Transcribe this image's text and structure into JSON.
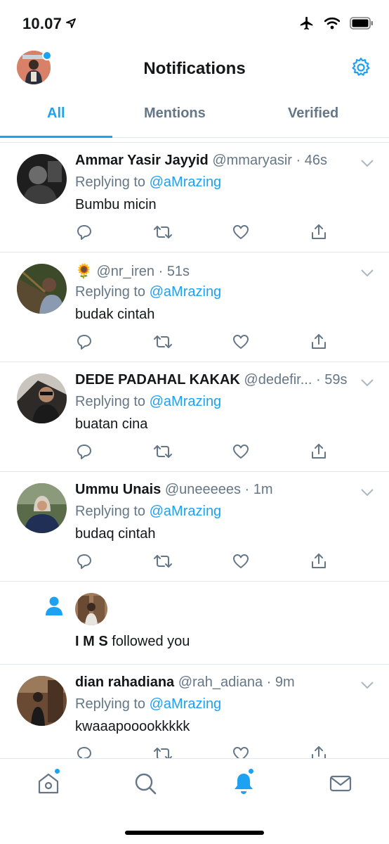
{
  "status_bar": {
    "time": "10.07"
  },
  "header": {
    "title": "Notifications"
  },
  "tabs": [
    {
      "label": "All",
      "active": true
    },
    {
      "label": "Mentions",
      "active": false
    },
    {
      "label": "Verified",
      "active": false
    }
  ],
  "notifications": [
    {
      "type": "reply",
      "name": "Ammar Yasir Jayyid",
      "handle": "@mmaryasir",
      "time": "46s",
      "replying_prefix": "Replying to",
      "replying_to": "@aMrazing",
      "text": "Bumbu micin"
    },
    {
      "type": "reply",
      "name": "🌻",
      "handle": "@nr_iren",
      "time": "51s",
      "replying_prefix": "Replying to",
      "replying_to": "@aMrazing",
      "text": "budak cintah"
    },
    {
      "type": "reply",
      "name": "DEDE PADAHAL KAKAK",
      "handle": "@dedefir...",
      "time": "59s",
      "replying_prefix": "Replying to",
      "replying_to": "@aMrazing",
      "text": "buatan cina"
    },
    {
      "type": "reply",
      "name": "Ummu Unais",
      "handle": "@uneeeees",
      "time": "1m",
      "replying_prefix": "Replying to",
      "replying_to": "@aMrazing",
      "text": "budaq cintah"
    },
    {
      "type": "follow",
      "name": "I M S",
      "text": "followed you"
    },
    {
      "type": "reply",
      "name": "dian rahadiana",
      "handle": "@rah_adiana",
      "time": "9m",
      "replying_prefix": "Replying to",
      "replying_to": "@aMrazing",
      "text": "kwaaapooookkkkk"
    }
  ],
  "colors": {
    "accent": "#1da1f2",
    "text": "#14171a",
    "muted": "#657786",
    "divider": "#e1e8ed"
  },
  "bottom_nav": [
    {
      "icon": "home-icon",
      "badge": true
    },
    {
      "icon": "search-icon",
      "badge": false
    },
    {
      "icon": "bell-icon",
      "badge": true,
      "active": true
    },
    {
      "icon": "mail-icon",
      "badge": false
    }
  ]
}
